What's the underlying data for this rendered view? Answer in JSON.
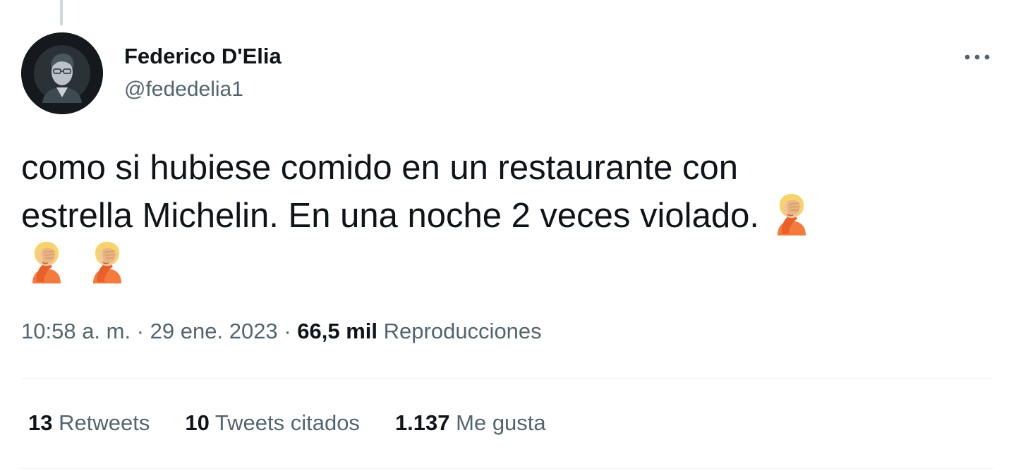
{
  "tweet": {
    "author": {
      "name": "Federico D'Elia",
      "handle": "@fededelia1"
    },
    "text_line1": "como si hubiese comido en un restaurante con",
    "text_line2": "estrella Michelin. En una noche 2 veces violado.",
    "emoji": "person-facepalming",
    "meta": {
      "time": "10:58 a. m.",
      "sep1": "·",
      "date": "29 ene. 2023",
      "sep2": "·",
      "views_count": "66,5 mil",
      "views_label": "Reproducciones"
    },
    "stats": {
      "retweets_count": "13",
      "retweets_label": "Retweets",
      "quotes_count": "10",
      "quotes_label": "Tweets citados",
      "likes_count": "1.137",
      "likes_label": "Me gusta"
    }
  },
  "icons": {
    "more": "more-horizontal-icon"
  },
  "colors": {
    "text_primary": "#0f1419",
    "text_secondary": "#536471",
    "divider": "#eff3f4",
    "emoji_skin": "#f3c799",
    "emoji_hair": "#f6d36b",
    "emoji_shirt": "#f47b3d"
  }
}
